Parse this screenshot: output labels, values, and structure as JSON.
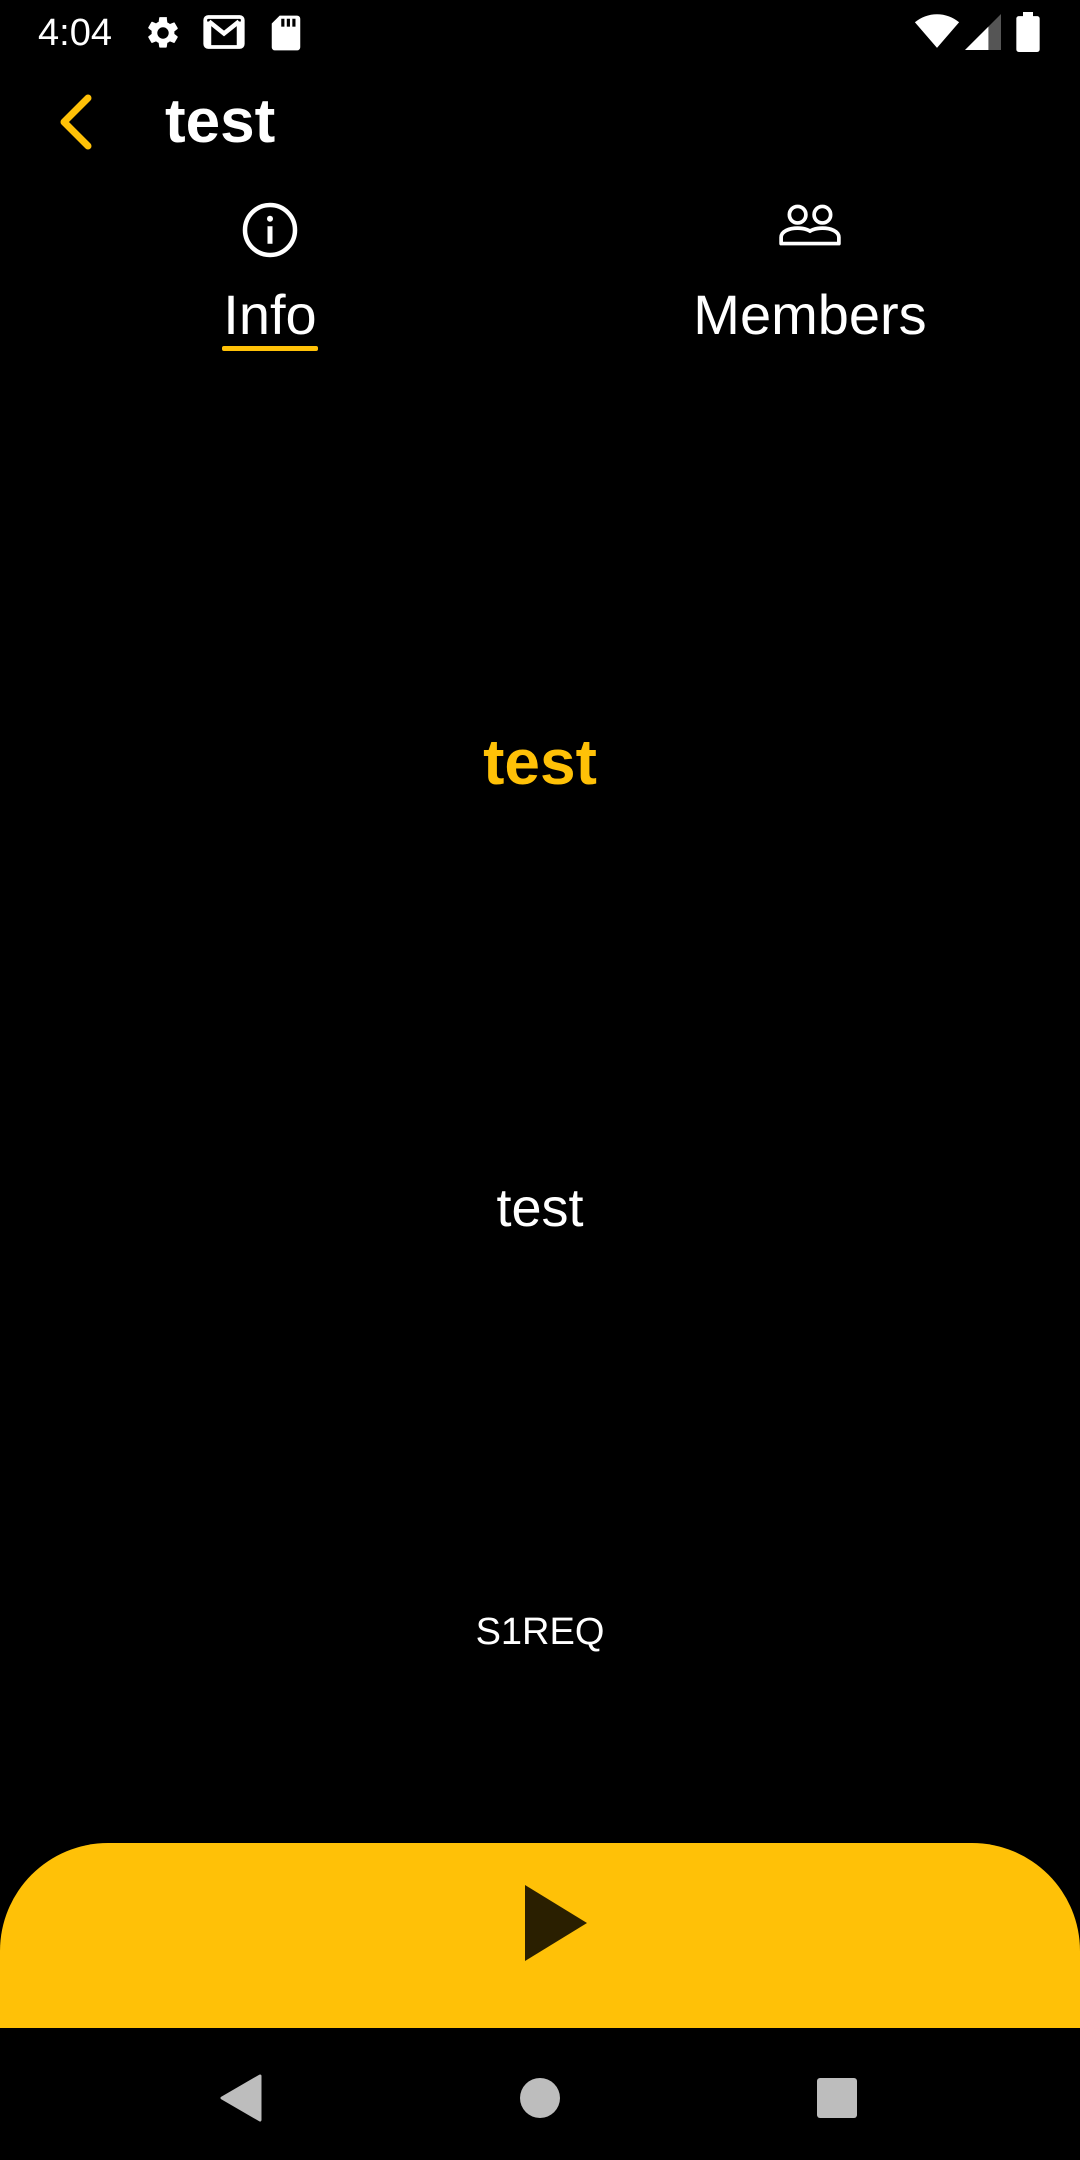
{
  "status_bar": {
    "time": "4:04",
    "left_icons": [
      "gear-icon",
      "gmail-icon",
      "sd-card-icon"
    ],
    "right_icons": [
      "wifi-icon",
      "signal-icon",
      "battery-icon"
    ]
  },
  "app_bar": {
    "title": "test",
    "back_icon": "chevron-left-icon"
  },
  "tabs": [
    {
      "label": "Info",
      "icon": "info-icon",
      "selected": true
    },
    {
      "label": "Members",
      "icon": "group-icon",
      "selected": false
    }
  ],
  "content": {
    "name": "test",
    "description": "test",
    "code": "S1REQ"
  },
  "play_bar": {
    "icon": "play-icon"
  },
  "nav_bar": {
    "icons": [
      "nav-back-icon",
      "nav-home-icon",
      "nav-recents-icon"
    ]
  },
  "colors": {
    "accent": "#FFC107",
    "background": "#000000",
    "text": "#FFFFFF"
  }
}
